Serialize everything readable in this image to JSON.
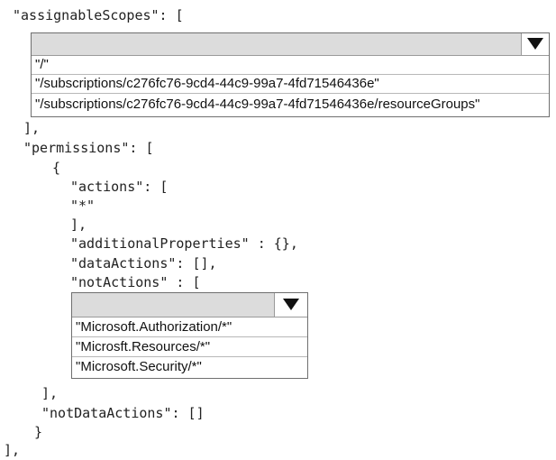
{
  "code_lines": {
    "assignable_scopes_open": "\"assignableScopes\": [",
    "assignable_scopes_close": "],",
    "permissions_open": "\"permissions\": [",
    "brace_open": "{",
    "actions_open": "\"actions\": [",
    "actions_item": "\"*\"",
    "actions_close": "],",
    "additional_properties": "\"additionalProperties\" : {},",
    "data_actions": "\"dataActions\": [],",
    "not_actions_open": "\"notActions\" : [",
    "not_actions_close": "],",
    "not_data_actions": "\"notDataActions\": []",
    "brace_close": "}",
    "permissions_close": "],"
  },
  "scopes_dropdown": {
    "selected": "",
    "options": [
      "\"/\"",
      "\"/subscriptions/c276fc76-9cd4-44c9-99a7-4fd71546436e\"",
      "\"/subscriptions/c276fc76-9cd4-44c9-99a7-4fd71546436e/resourceGroups\""
    ]
  },
  "not_actions_dropdown": {
    "selected": "",
    "options": [
      "\"Microsoft.Authorization/*\"",
      "\"Microsft.Resources/*\"",
      "\"Microsoft.Security/*\""
    ]
  }
}
